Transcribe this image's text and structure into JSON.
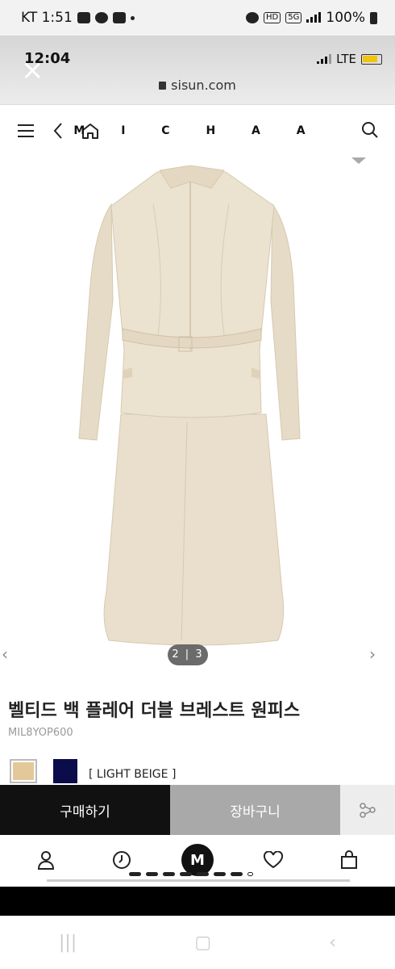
{
  "status_bar": {
    "carrier_time": "KT 1:51",
    "battery": "100%",
    "icons": [
      "gallery-icon",
      "talk-icon",
      "m-app-icon",
      "alarm-icon",
      "hd-icon",
      "5g-icon",
      "signal-icon",
      "battery-icon"
    ]
  },
  "browser": {
    "inner_time": "12:04",
    "network": "LTE",
    "url": "sisun.com",
    "close_label": "×"
  },
  "site": {
    "brand": "M I C H A A"
  },
  "product": {
    "pager": "2 | 3",
    "title": "벨티드 백 플레어 더블 브레스트 원피스",
    "code": "MIL8YOP600",
    "colors": [
      "#e3c99a",
      "#0b0c4a"
    ],
    "color_name": "[ LIGHT BEIGE ]",
    "dress_color": "#e9dfcc"
  },
  "actions": {
    "buy_label": "구매하기",
    "cart_label": "장바구니"
  },
  "bottom_nav": {
    "items": [
      "user-icon",
      "recent-clock-icon",
      "m-logo",
      "heart-icon",
      "bag-icon"
    ],
    "m_label": "M"
  }
}
